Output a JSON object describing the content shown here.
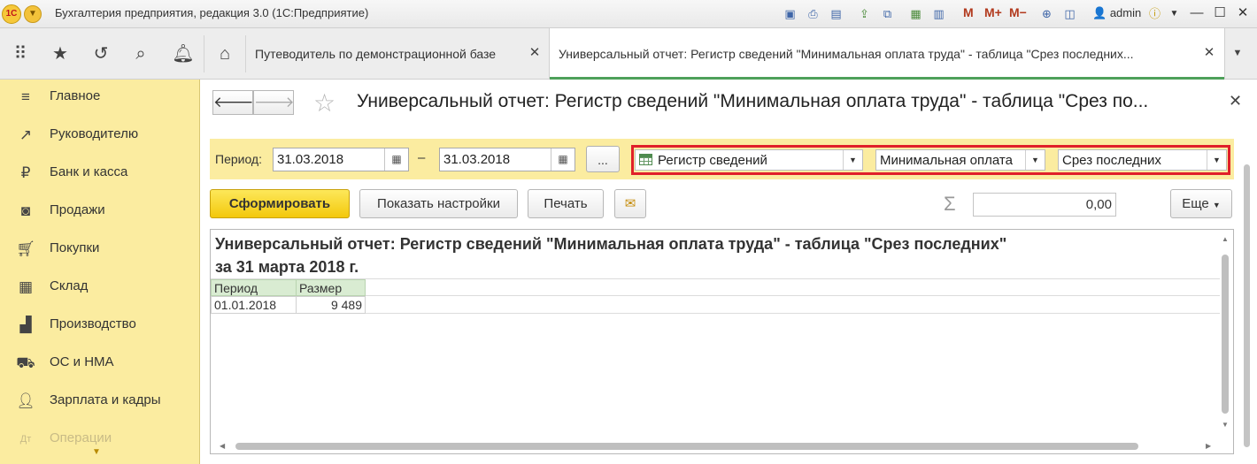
{
  "window": {
    "title": "Бухгалтерия предприятия, редакция 3.0  (1С:Предприятие)",
    "logo_text": "1С",
    "user": "admin",
    "memory_buttons": [
      "M",
      "M+",
      "M−"
    ]
  },
  "tabs": [
    {
      "label": "Путеводитель по демонстрационной базе",
      "active": false
    },
    {
      "label": "Универсальный отчет: Регистр сведений \"Минимальная оплата труда\" - таблица \"Срез последних...",
      "active": true
    }
  ],
  "sidebar": {
    "items": [
      {
        "label": "Главное",
        "icon": "menu-lines-icon"
      },
      {
        "label": "Руководителю",
        "icon": "trend-icon"
      },
      {
        "label": "Банк и касса",
        "icon": "ruble-icon"
      },
      {
        "label": "Продажи",
        "icon": "bag-icon"
      },
      {
        "label": "Покупки",
        "icon": "cart-icon"
      },
      {
        "label": "Склад",
        "icon": "warehouse-icon"
      },
      {
        "label": "Производство",
        "icon": "factory-icon"
      },
      {
        "label": "ОС и НМА",
        "icon": "truck-icon"
      },
      {
        "label": "Зарплата и кадры",
        "icon": "person-icon"
      },
      {
        "label": "Операции",
        "icon": "operations-icon"
      }
    ]
  },
  "form": {
    "title": "Универсальный отчет: Регистр сведений \"Минимальная оплата труда\" - таблица \"Срез по...",
    "period_label": "Период:",
    "date_from": "31.03.2018",
    "date_to": "31.03.2018",
    "dash": "–",
    "dots_label": "...",
    "object_type": "Регистр сведений",
    "object_name": "Минимальная оплата",
    "table_type": "Срез последних",
    "highlight_color": "#e0202a"
  },
  "toolbar": {
    "generate_label": "Сформировать",
    "settings_label": "Показать настройки",
    "print_label": "Печать",
    "sum_value": "0,00",
    "more_label": "Еще"
  },
  "report": {
    "title": "Универсальный отчет: Регистр сведений \"Минимальная оплата труда\" - таблица \"Срез последних\" за 31 марта 2018 г.",
    "columns": [
      "Период",
      "Размер"
    ],
    "rows": [
      {
        "period": "01.01.2018",
        "amount": "9 489"
      }
    ]
  }
}
